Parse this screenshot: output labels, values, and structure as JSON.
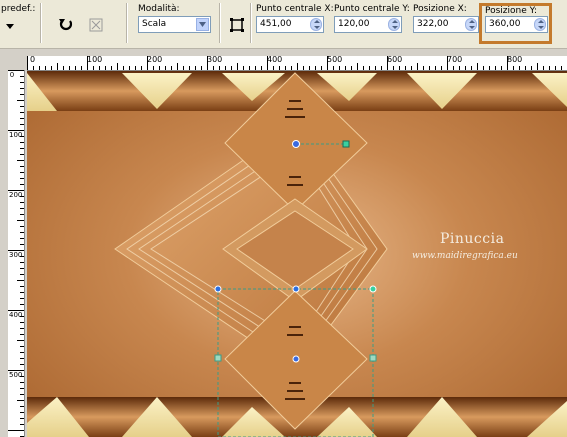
{
  "toolbar": {
    "preset_label": "predef.:",
    "mode_label": "Modalità:",
    "mode_value": "Scala",
    "center_x_label": "Punto centrale X:",
    "center_x_value": "451,00",
    "center_y_label": "Punto centrale Y:",
    "center_y_value": "120,00",
    "pos_x_label": "Posizione X:",
    "pos_x_value": "322,00",
    "pos_y_label": "Posizione Y:",
    "pos_y_value": "360,00"
  },
  "ruler": {
    "top_ticks": [
      "0",
      "100",
      "200",
      "300",
      "400",
      "500",
      "600",
      "700",
      "800"
    ],
    "left_ticks": [
      "0",
      "100",
      "200",
      "300",
      "400",
      "500"
    ]
  },
  "watermark": {
    "title": "Pinuccia",
    "url": "www.maidiregrafica.eu"
  },
  "colors": {
    "accent_highlight": "#c47a2c",
    "wood_light": "#d9a06b",
    "wood_dark": "#7a3f14",
    "triangle_cream": "#f4e8b0",
    "handle_line": "#2fbfa0"
  },
  "icons": [
    "preset-dropdown-icon",
    "reset-icon",
    "flip-icon",
    "distort-icon"
  ]
}
